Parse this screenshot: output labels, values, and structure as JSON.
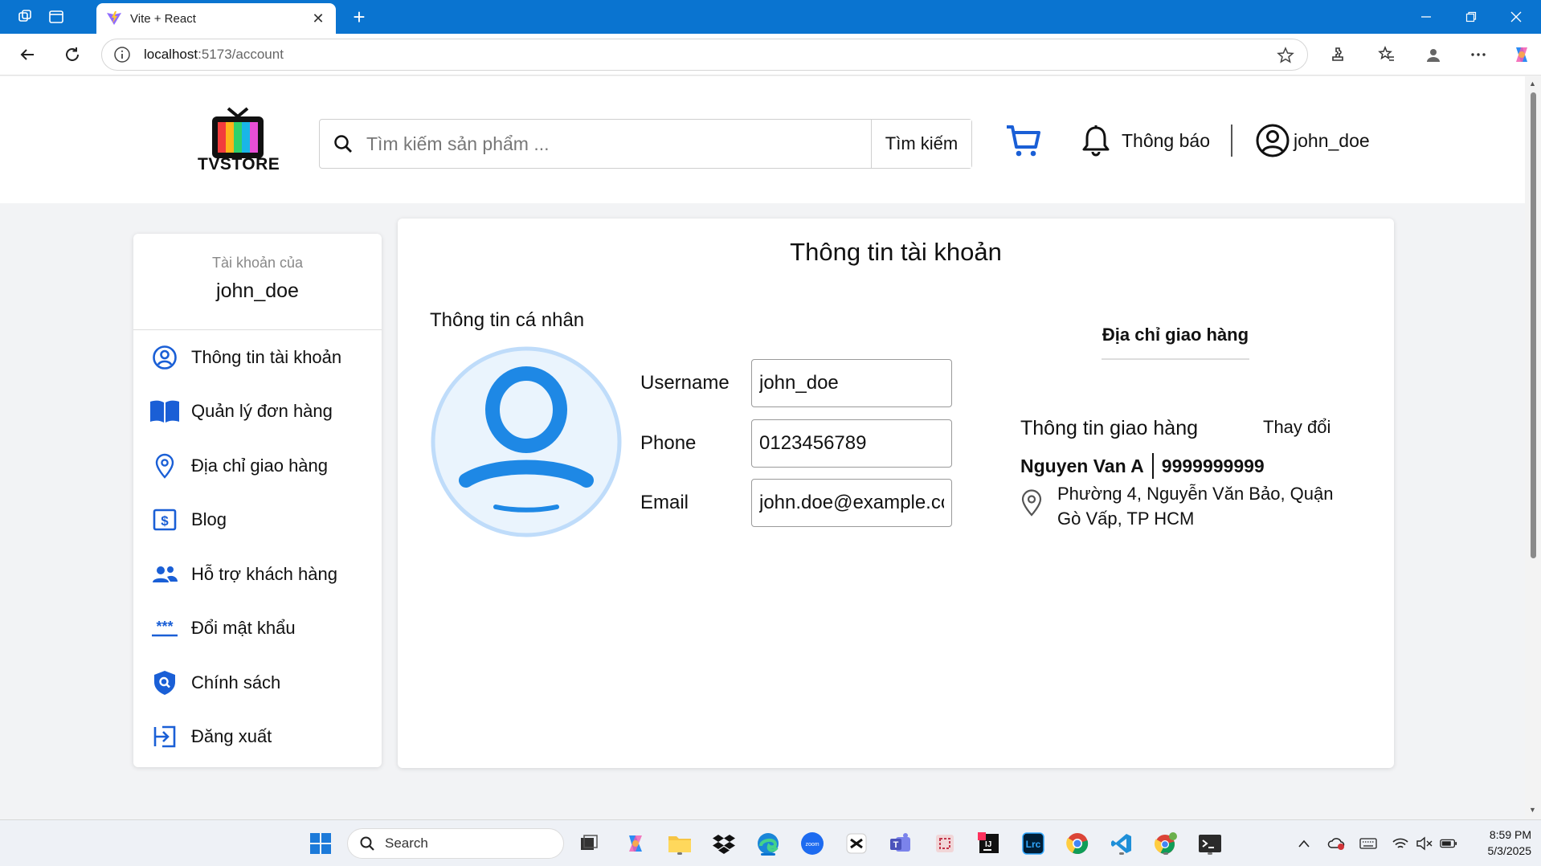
{
  "browser": {
    "tab_title": "Vite + React",
    "url_host": "localhost",
    "url_path": ":5173/account"
  },
  "header": {
    "logo_text": "TVSTORE",
    "search_placeholder": "Tìm kiếm sản phẩm ...",
    "search_button": "Tìm kiếm",
    "notifications_label": "Thông báo",
    "username": "john_doe"
  },
  "sidebar": {
    "caption": "Tài khoản của",
    "username": "john_doe",
    "items": [
      {
        "label": "Thông tin tài khoản",
        "icon": "user-circle-icon"
      },
      {
        "label": "Quản lý đơn hàng",
        "icon": "book-icon"
      },
      {
        "label": "Địa chỉ giao hàng",
        "icon": "location-pin-icon"
      },
      {
        "label": "Blog",
        "icon": "dollar-document-icon"
      },
      {
        "label": "Hỗ trợ khách hàng",
        "icon": "users-icon"
      },
      {
        "label": "Đổi mật khẩu",
        "icon": "password-icon"
      },
      {
        "label": "Chính sách",
        "icon": "shield-search-icon"
      },
      {
        "label": "Đăng xuất",
        "icon": "logout-icon"
      }
    ]
  },
  "account": {
    "title": "Thông tin tài khoản",
    "personal_title": "Thông tin cá nhân",
    "fields": [
      {
        "label": "Username",
        "value": "john_doe"
      },
      {
        "label": "Phone",
        "value": "0123456789"
      },
      {
        "label": "Email",
        "value": "john.doe@example.com"
      }
    ]
  },
  "shipping": {
    "tab_label": "Địa chỉ giao hàng",
    "title": "Thông tin giao hàng",
    "change_label": "Thay đổi",
    "name": "Nguyen Van A",
    "phone": "9999999999",
    "address": "Phường 4, Nguyễn Văn Bảo, Quận Gò Vấp, TP HCM"
  },
  "taskbar": {
    "search_label": "Search",
    "time": "8:59 PM",
    "date": "5/3/2025"
  },
  "colors": {
    "browser_blue": "#0a74d0",
    "accent_blue": "#1a5fd6",
    "avatar_blue": "#1e88e5"
  }
}
